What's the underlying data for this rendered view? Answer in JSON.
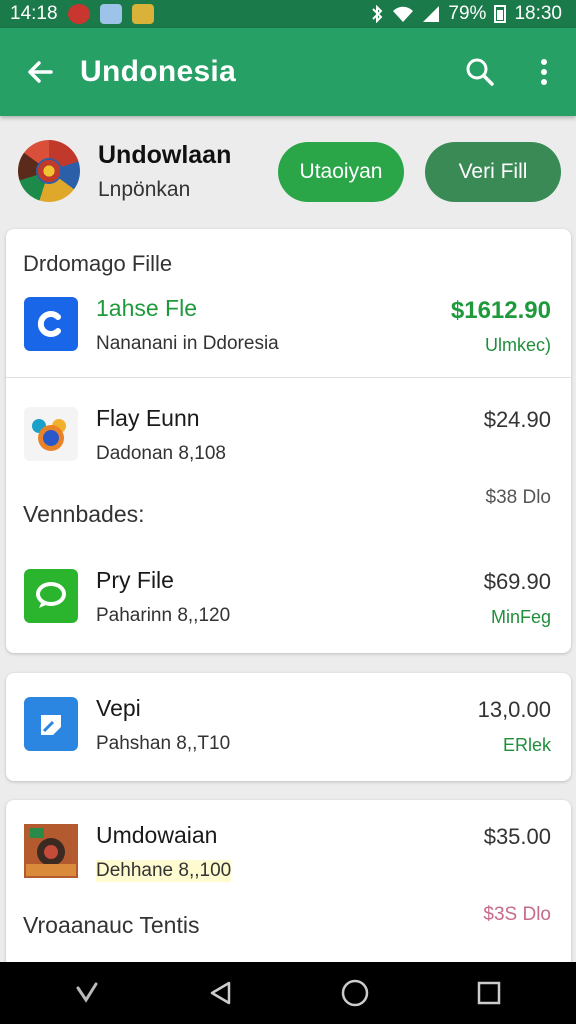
{
  "status_bar": {
    "time_left": "14:18",
    "battery": "79%",
    "time_right": "18:30"
  },
  "app_bar": {
    "title": "Undonesia"
  },
  "header": {
    "title": "Undowlaan",
    "subtitle": "Lnpönkan",
    "primary_button": "Utaoiyan",
    "secondary_button": "Veri Fill"
  },
  "card1": {
    "section_title": "Drdomago Fille",
    "items": [
      {
        "title": "1ahse Fle",
        "subtitle": "Nananani in Ddoresia",
        "price": "$1612.90",
        "status": "Ulmkec)",
        "icon": "c-app-icon"
      },
      {
        "title": "Flay Eunn",
        "subtitle": "Dadonan 8,108",
        "price": "$24.90",
        "status": "",
        "icon": "chrome-icon"
      }
    ],
    "mid_label": "Vennbades:",
    "mid_price": "$38 Dlo",
    "items2": [
      {
        "title": "Pry File",
        "subtitle": "Paharinn 8,,120",
        "price": "$69.90",
        "status": "MinFeg",
        "icon": "chat-bubble-icon"
      }
    ]
  },
  "card2": {
    "items": [
      {
        "title": "Vepi",
        "subtitle": "Pahshan 8,,T10",
        "price": "13,0.00",
        "status": "ERlek",
        "icon": "docs-icon"
      }
    ]
  },
  "card3": {
    "items": [
      {
        "title": "Umdowaian",
        "subtitle": "Dehhane 8,,100",
        "price": "$35.00",
        "status": "",
        "icon": "photo-thumb-icon"
      }
    ],
    "footer_label": "Vroaanauc Tentis",
    "footer_price": "$3S Dlo"
  },
  "colors": {
    "status_bar": "#1b7a4a",
    "app_bar": "#26a065",
    "accent_green": "#1e9a3c",
    "pill_green": "#2aa649",
    "pill_dark": "#3a8a55"
  }
}
